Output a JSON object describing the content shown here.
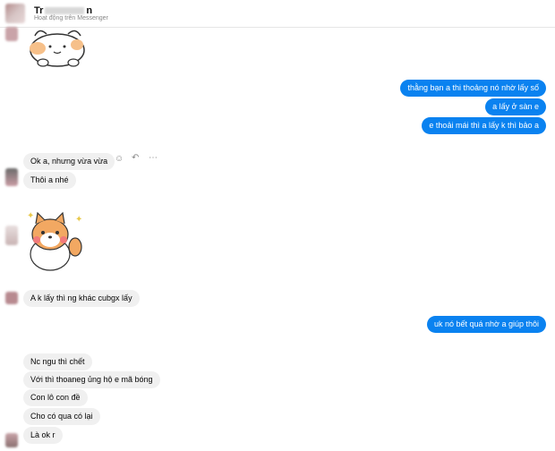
{
  "header": {
    "name_start": "Tr",
    "name_end": "n",
    "status": "Hoạt động trên Messenger"
  },
  "messages": {
    "out1": "thằng bạn a thi thoảng nó nhờ lấy số",
    "out2": "a lấy ở sàn e",
    "out3": "e thoải mái thì a lấy k thì bảo a",
    "in1": "Ok a, nhưng vừa vừa",
    "in2": "Thôi a nhé",
    "in3": "A k lấy thì ng khác cubgx lấy",
    "out4": "uk nó bết quá nhờ a giúp thôi",
    "in4": "Nc ngu thì chết",
    "in5": "Với thì thoaneg ủng hộ e mã bóng",
    "in6": "Con lô con đề",
    "in7": "Cho có qua có lại",
    "in8": "Là ok r"
  },
  "actions": {
    "react_icon": "smiley-icon",
    "reply_icon": "reply-icon",
    "more_icon": "more-icon"
  },
  "colors": {
    "outgoing": "#0a82f0",
    "incoming": "#f0f0f0"
  }
}
